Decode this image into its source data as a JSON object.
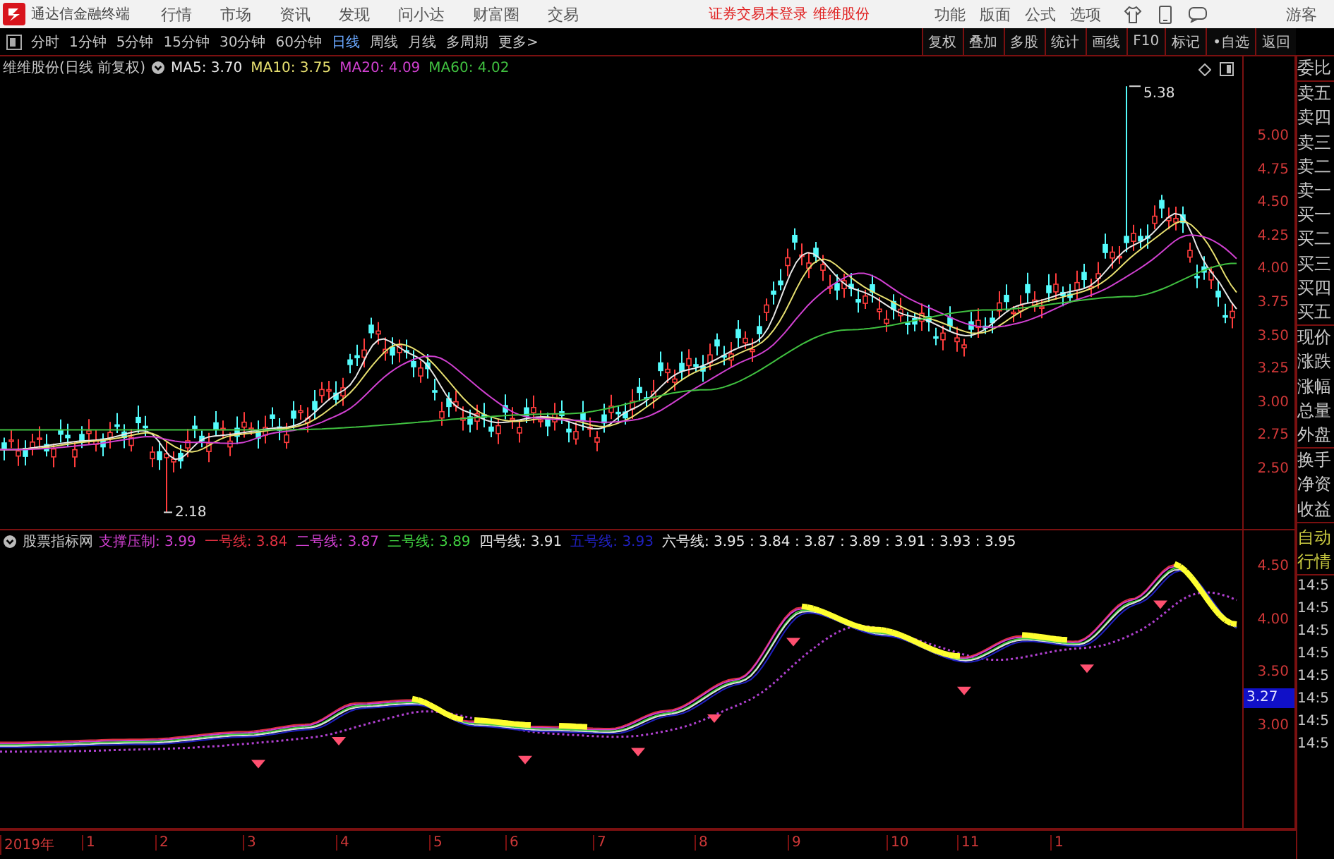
{
  "app": {
    "title": "通达信金融终端",
    "menu": [
      "行情",
      "市场",
      "资讯",
      "发现",
      "问小达",
      "财富圈",
      "交易"
    ],
    "notice": "证券交易未登录",
    "account": "维维股份",
    "actions": [
      "功能",
      "版面",
      "公式",
      "选项"
    ],
    "user": "游客"
  },
  "toolbar": {
    "periods": [
      {
        "label": "分时",
        "selected": false
      },
      {
        "label": "1分钟",
        "selected": false
      },
      {
        "label": "5分钟",
        "selected": false
      },
      {
        "label": "15分钟",
        "selected": false
      },
      {
        "label": "30分钟",
        "selected": false
      },
      {
        "label": "60分钟",
        "selected": false
      },
      {
        "label": "日线",
        "selected": true
      },
      {
        "label": "周线",
        "selected": false
      },
      {
        "label": "月线",
        "selected": false
      },
      {
        "label": "多周期",
        "selected": false
      },
      {
        "label": "更多>",
        "selected": false
      }
    ],
    "tools": [
      "复权",
      "叠加",
      "多股",
      "统计",
      "画线",
      "F10",
      "标记",
      "•自选",
      "返回"
    ]
  },
  "price_panel": {
    "title": "维维股份(日线 前复权)",
    "averages": [
      {
        "label": "MA5: 3.70",
        "color": "#e8e8e8"
      },
      {
        "label": "MA10: 3.75",
        "color": "#e8e070"
      },
      {
        "label": "MA20: 4.09",
        "color": "#d040d0"
      },
      {
        "label": "MA60: 4.02",
        "color": "#40c040"
      }
    ],
    "high_mark": "5.38",
    "low_mark": "2.18",
    "axis": [
      "5.00",
      "4.75",
      "4.50",
      "4.25",
      "4.00",
      "3.75",
      "3.50",
      "3.25",
      "3.00",
      "2.75",
      "2.50"
    ]
  },
  "indicator_panel": {
    "title": "股票指标网",
    "lines": [
      {
        "label": "支撑压制: 3.99",
        "color": "#d040d0"
      },
      {
        "label": "一号线: 3.84",
        "color": "#e03040"
      },
      {
        "label": "二号线: 3.87",
        "color": "#d040d0"
      },
      {
        "label": "三号线: 3.89",
        "color": "#40d040"
      },
      {
        "label": "四号线: 3.91",
        "color": "#e0e0e0"
      },
      {
        "label": "五号线: 3.93",
        "color": "#2020c0"
      },
      {
        "label": "六号线: 3.95 : 3.84 : 3.87 : 3.89 : 3.91 : 3.93 : 3.95",
        "color": "#e8e8e8"
      }
    ],
    "axis": [
      "4.50",
      "4.00",
      "3.50",
      "3.00"
    ],
    "current": "3.27"
  },
  "time_axis": [
    "2019年",
    "1",
    "2",
    "3",
    "4",
    "5",
    "6",
    "7",
    "8",
    "9",
    "10",
    "11",
    "1"
  ],
  "sidebar": {
    "quote_labels": [
      [
        "委比"
      ],
      [
        "卖五",
        "卖四",
        "卖三",
        "卖二",
        "卖一",
        "买一",
        "买二",
        "买三",
        "买四",
        "买五"
      ],
      [
        "现价",
        "涨跌",
        "涨幅",
        "总量",
        "外盘"
      ],
      [
        "换手",
        "净资",
        "收益"
      ]
    ],
    "status_labels": [
      "自动",
      "行情"
    ],
    "times": [
      "14:5",
      "14:5",
      "14:5",
      "14:5",
      "14:5",
      "14:5",
      "14:5",
      "14:5"
    ]
  }
}
